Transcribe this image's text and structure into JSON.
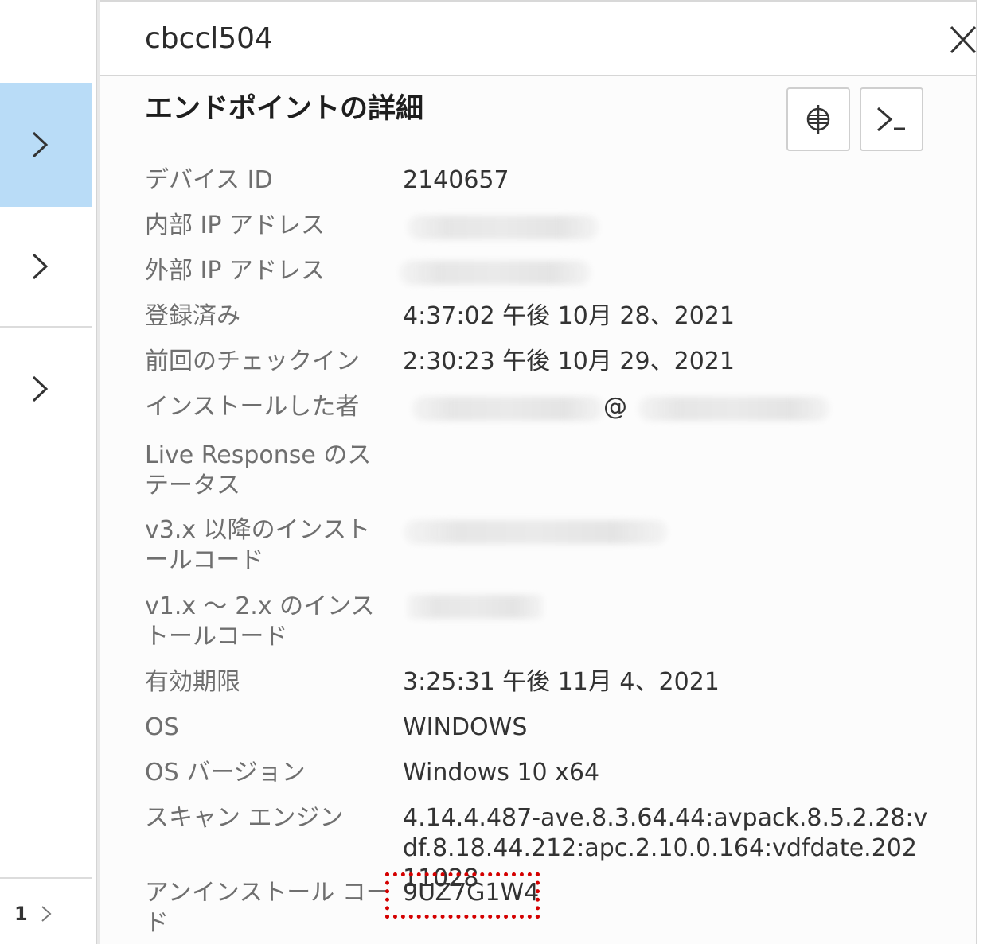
{
  "sidebar": {
    "pager": {
      "page": "1"
    }
  },
  "panel": {
    "title": "cbccl504",
    "section_title": "エンドポイントの詳細"
  },
  "details": [
    {
      "label": "デバイス ID",
      "value": "2140657"
    },
    {
      "label": "内部 IP アドレス",
      "value": ""
    },
    {
      "label": "外部 IP アドレス",
      "value": ""
    },
    {
      "label": "登録済み",
      "value": "4:37:02 午後 10月 28、2021"
    },
    {
      "label": "前回のチェックイン",
      "value": "2:30:23 午後 10月 29、2021"
    },
    {
      "label": "インストールした者",
      "value": "@"
    },
    {
      "label": "Live Response のステータス",
      "value": ""
    },
    {
      "label": "v3.x 以降のインストールコード",
      "value": ""
    },
    {
      "label": "v1.x ～ 2.x のインストールコード",
      "value": ""
    },
    {
      "label": "有効期限",
      "value": "3:25:31 午後 11月 4、2021"
    },
    {
      "label": "OS",
      "value": "WINDOWS"
    },
    {
      "label": "OS バージョン",
      "value": "Windows 10 x64"
    },
    {
      "label": "スキャン エンジン",
      "value": "4.14.4.487-ave.8.3.64.44:avpack.8.5.2.28:vdf.8.18.44.212:apc.2.10.0.164:vdfdate.20211028"
    },
    {
      "label": "アンインストール コード",
      "value": "9UZ7G1W4"
    }
  ],
  "colors": {
    "active_row": "#b9dcf7",
    "highlight": "#d40000"
  },
  "icons": {
    "locate": "crosshair-globe-icon",
    "terminal": "terminal-icon",
    "close": "close-icon",
    "chevron": "chevron-right-icon"
  }
}
